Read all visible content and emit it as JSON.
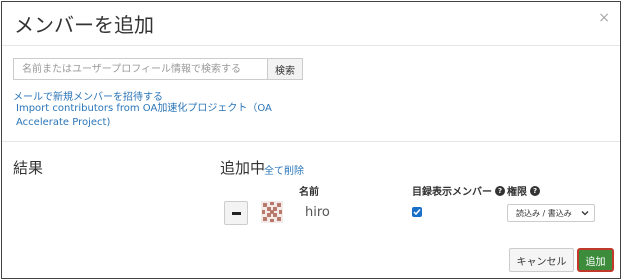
{
  "modal": {
    "title": "メンバーを追加",
    "close_glyph": "×"
  },
  "search": {
    "placeholder": "名前またはユーザープロフィール情報で検索する",
    "button_label": "検索"
  },
  "links": {
    "invite_email": "メールで新規メンバーを招待する",
    "import_contributors": "Import contributors from OA加速化プロジェクト（OA Accelerate Project)"
  },
  "results": {
    "label": "結果"
  },
  "adding": {
    "label": "追加中",
    "clear_all": "全て削除",
    "columns": {
      "name": "名前",
      "catalog_member": "目録表示メンバー",
      "permission": "権限"
    },
    "members": [
      {
        "name": "hiro",
        "catalog_member_checked": true,
        "permission": "読込み / 書込み"
      }
    ]
  },
  "footer": {
    "cancel_label": "キャンセル",
    "add_label": "追加"
  },
  "colors": {
    "link": "#2a75b8",
    "add_button": "#3c8c3c",
    "add_button_border": "#c0392b",
    "checkbox": "#1a6fc7"
  },
  "icons": {
    "close": "close-icon",
    "help": "help-icon",
    "remove": "minus-icon",
    "chevron": "chevron-down-icon",
    "check": "check-icon"
  }
}
